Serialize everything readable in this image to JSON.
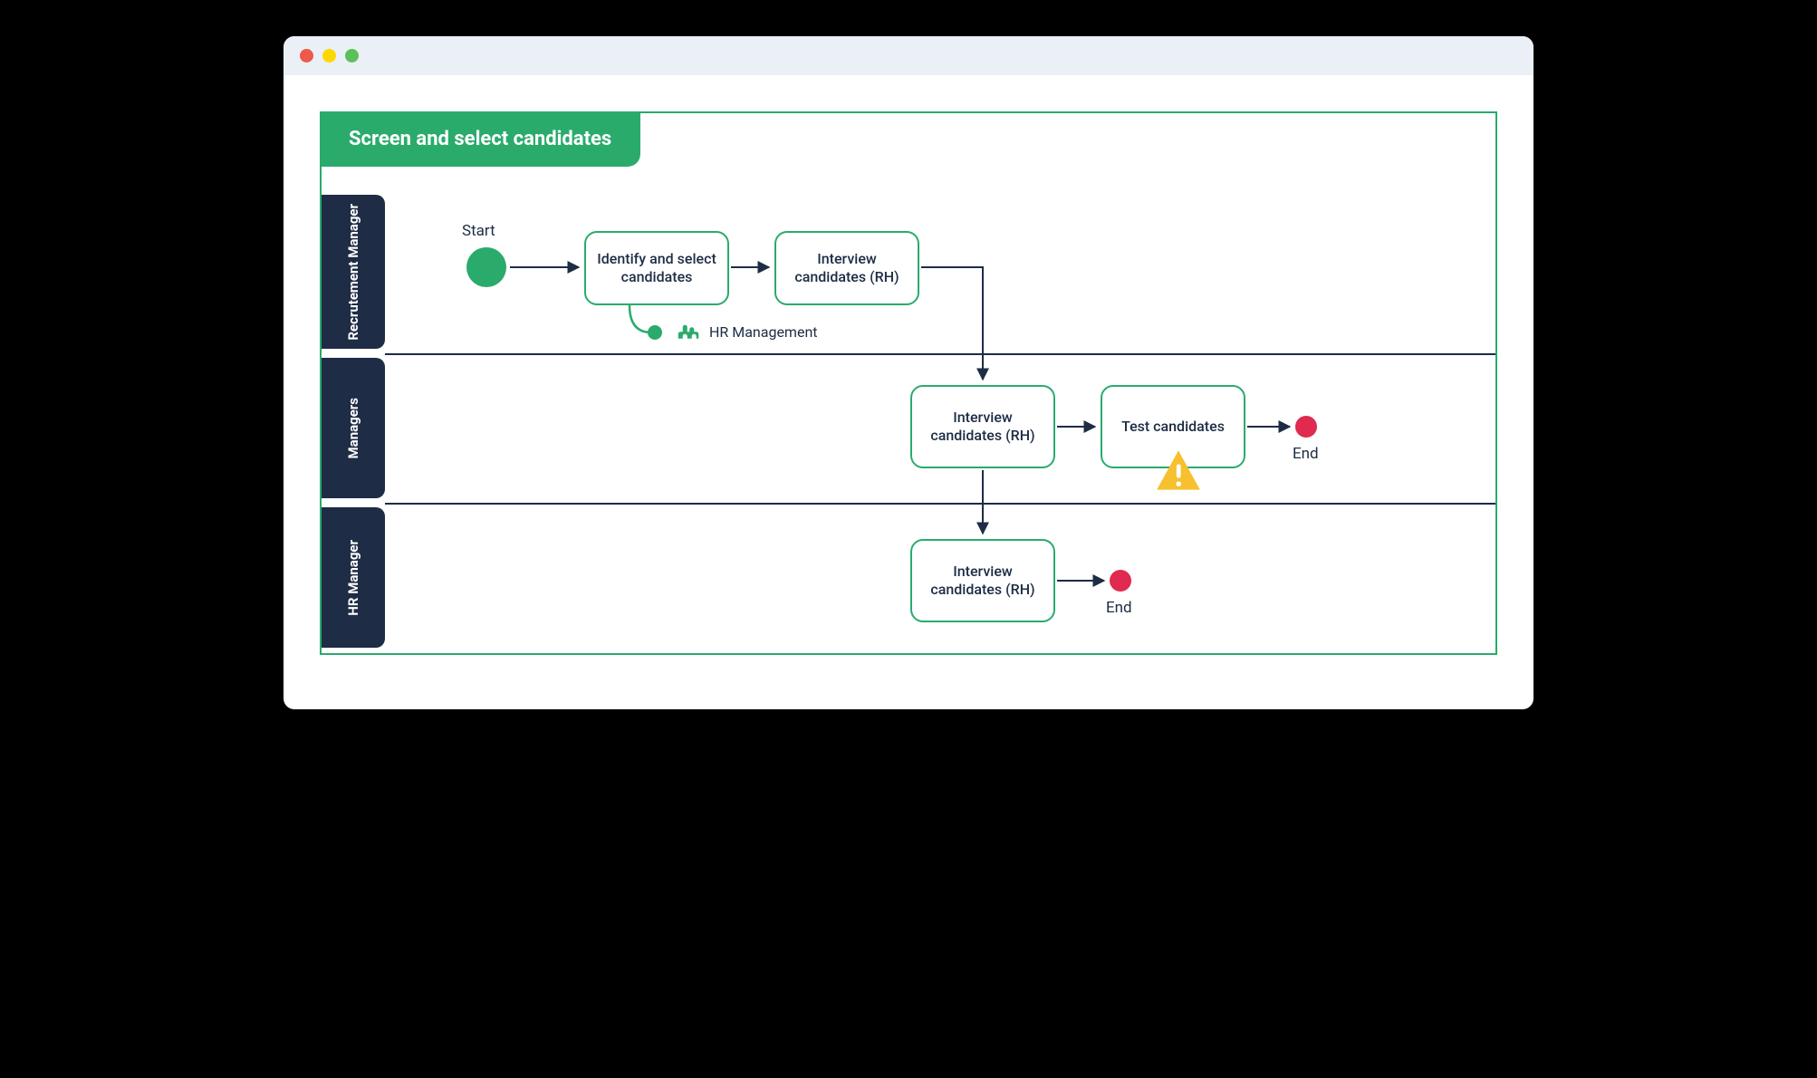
{
  "title": "Screen and select candidates",
  "lanes": [
    {
      "name": "Recrutement Manager"
    },
    {
      "name": "Managers"
    },
    {
      "name": "HR Manager"
    }
  ],
  "start_label": "Start",
  "end_label": "End",
  "tasks": {
    "identify": "Identify and select candidates",
    "interview_rh_1": "Interview candidates (RH)",
    "interview_rh_2": "Interview candidates (RH)",
    "test": "Test candidates",
    "interview_rh_3": "Interview candidates (RH)"
  },
  "subprocess": "HR Management"
}
